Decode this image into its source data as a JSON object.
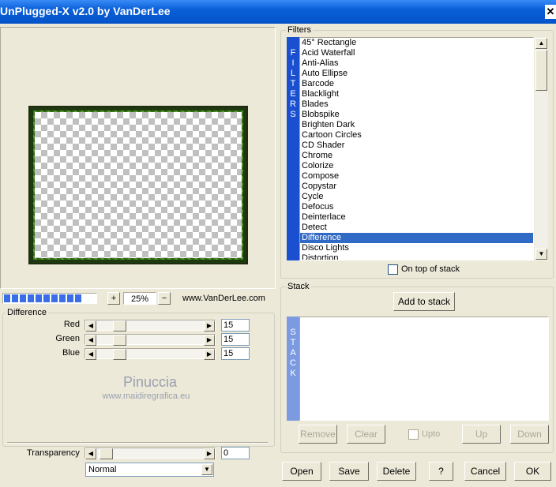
{
  "window": {
    "title": "UnPlugged-X v2.0 by VanDerLee",
    "close_glyph": "✕"
  },
  "zoom": {
    "plus": "+",
    "value": "25%",
    "minus": "−",
    "website": "www.VanDerLee.com",
    "progress": 0.85
  },
  "difference": {
    "label": "Difference",
    "sliders": [
      {
        "label": "Red",
        "value": "15"
      },
      {
        "label": "Green",
        "value": "15"
      },
      {
        "label": "Blue",
        "value": "15"
      }
    ]
  },
  "watermark": {
    "name": "Pinuccia",
    "url": "www.maidiregrafica.eu"
  },
  "transparency": {
    "label": "Transparency",
    "value": "0"
  },
  "blend_mode": {
    "selected": "Normal"
  },
  "filters": {
    "label": "Filters",
    "tab_letters": [
      "F",
      "I",
      "L",
      "T",
      "E",
      "R",
      "S"
    ],
    "items": [
      "45° Rectangle",
      "Acid Waterfall",
      "Anti-Alias",
      "Auto Ellipse",
      "Barcode",
      "Blacklight",
      "Blades",
      "Blobspike",
      "Brighten Dark",
      "Cartoon Circles",
      "CD Shader",
      "Chrome",
      "Colorize",
      "Compose",
      "Copystar",
      "Cycle",
      "Defocus",
      "Deinterlace",
      "Detect",
      "Difference",
      "Disco Lights",
      "Distortion"
    ],
    "selected_index": 19,
    "on_top_label": "On top of stack"
  },
  "stack": {
    "label": "Stack",
    "add_label": "Add to stack",
    "tab_letters": [
      "S",
      "T",
      "A",
      "C",
      "K"
    ],
    "remove_label": "Remove",
    "clear_label": "Clear",
    "upto_label": "Upto",
    "up_label": "Up",
    "down_label": "Down"
  },
  "buttons": {
    "open": "Open",
    "save": "Save",
    "delete": "Delete",
    "help": "?",
    "cancel": "Cancel",
    "ok": "OK"
  },
  "colors": {
    "titlebar": "#0453c8",
    "selection": "#316ac5",
    "tab": "#1a4fd0",
    "stack_tab": "#7c9ae0"
  }
}
